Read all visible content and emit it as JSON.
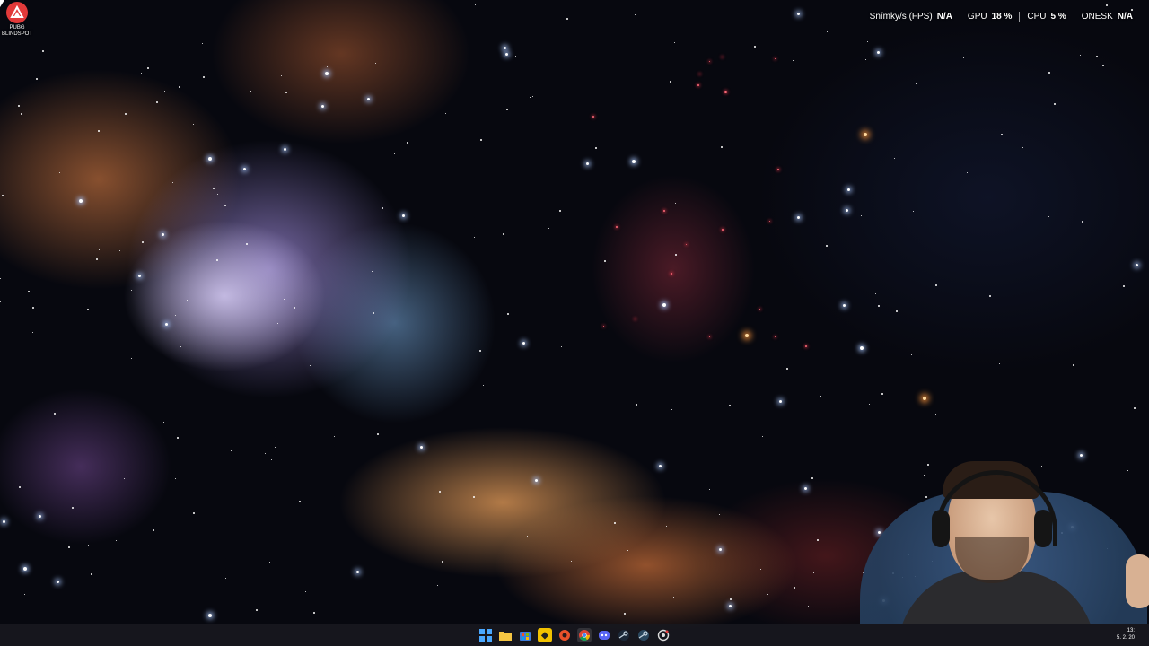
{
  "desktop": {
    "icons": [
      {
        "label_line1": "PUBG",
        "label_line2": "BLINDSPOT",
        "icon": "pubg-blindspot-icon"
      }
    ]
  },
  "performance_overlay": {
    "items": [
      {
        "label": "Snímky/s (FPS)",
        "value": "N/A"
      },
      {
        "label": "GPU",
        "value": "18 %"
      },
      {
        "label": "CPU",
        "value": "5 %"
      },
      {
        "label": "ONESK",
        "value": "N/A"
      }
    ]
  },
  "taskbar": {
    "icons": [
      "windows-start-icon",
      "file-explorer-icon",
      "microsoft-store-icon",
      "notes-app-icon",
      "media-app-icon",
      "chrome-icon",
      "discord-icon",
      "steam-icon",
      "steam-icon",
      "camera-app-icon"
    ],
    "clock": {
      "time": "13:",
      "date": "5. 2. 20"
    }
  },
  "colors": {
    "accent": "#e23a3a",
    "overlay_text": "#ffffff",
    "taskbar_bg": "#18181e"
  }
}
